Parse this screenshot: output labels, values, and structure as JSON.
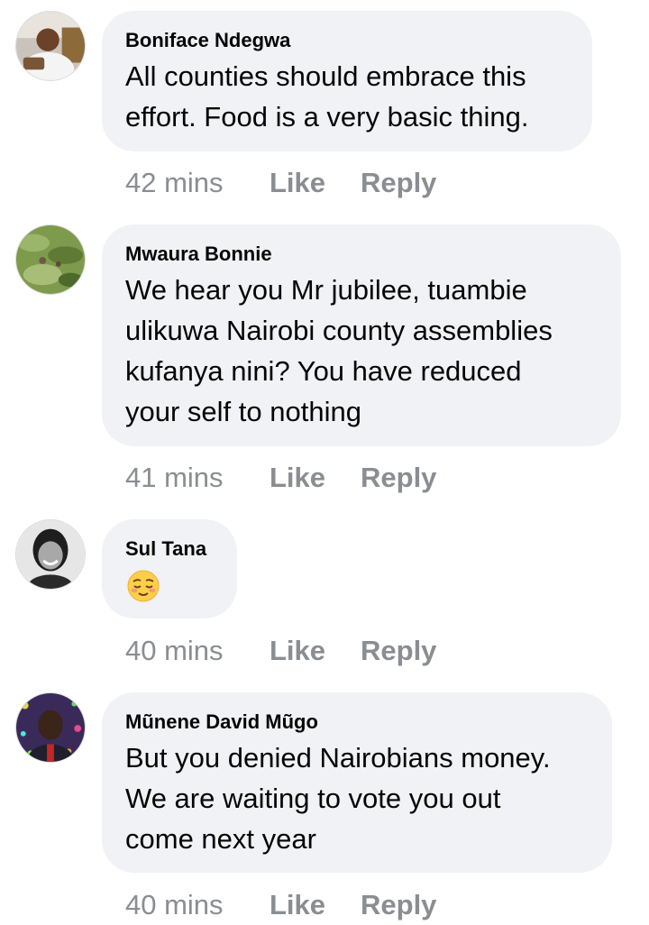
{
  "comments": [
    {
      "author": "Boniface Ndegwa",
      "lines": [
        "All counties should embrace this",
        "effort. Food is a very basic thing."
      ],
      "time": "42 mins",
      "like_label": "Like",
      "reply_label": "Reply",
      "avatar_icon": "user-photo"
    },
    {
      "author": "Mwaura Bonnie",
      "lines": [
        "We hear you Mr jubilee, tuambie",
        "ulikuwa Nairobi county assemblies",
        "kufanya nini? You have reduced",
        "your self to nothing"
      ],
      "time": "41 mins",
      "like_label": "Like",
      "reply_label": "Reply",
      "avatar_icon": "grass-photo"
    },
    {
      "author": "Sul Tana",
      "emoji": "relieved-face-emoji",
      "time": "40 mins",
      "like_label": "Like",
      "reply_label": "Reply",
      "avatar_icon": "user-photo"
    },
    {
      "author": "Mũnene David Mũgo",
      "lines": [
        "But you denied Nairobians money.",
        "We are waiting to vote you out",
        "come next year"
      ],
      "time": "40 mins",
      "like_label": "Like",
      "reply_label": "Reply",
      "avatar_icon": "user-photo"
    }
  ],
  "colors": {
    "bubble_bg": "#f0f2f5",
    "meta_text": "#8a8d91",
    "text": "#050505"
  }
}
